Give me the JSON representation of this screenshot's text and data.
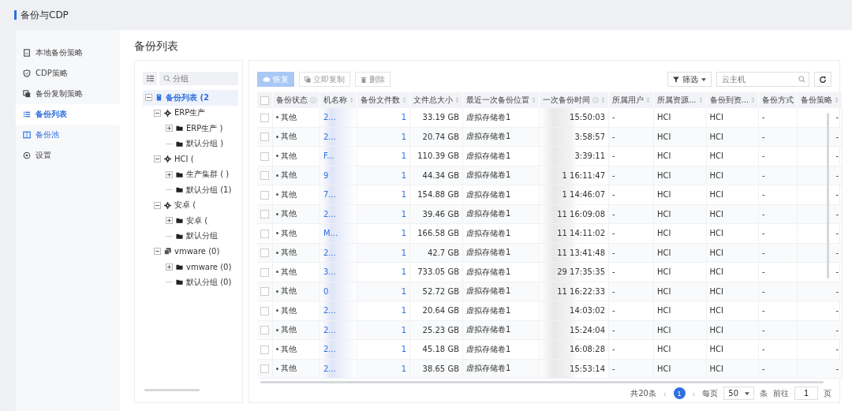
{
  "app_title": "备份与CDP",
  "sidebar": {
    "items": [
      {
        "label": "本地备份策略",
        "selected": false,
        "highlighted": false
      },
      {
        "label": "CDP策略",
        "selected": false,
        "highlighted": false
      },
      {
        "label": "备份复制策略",
        "selected": false,
        "highlighted": false
      },
      {
        "label": "备份列表",
        "selected": true,
        "highlighted": true
      },
      {
        "label": "备份池",
        "selected": false,
        "highlighted": true
      },
      {
        "label": "设置",
        "selected": false,
        "highlighted": false
      }
    ]
  },
  "page_title": "备份列表",
  "tree": {
    "search_placeholder": "分组",
    "nodes": [
      {
        "label": "备份列表 (2",
        "kind": "list",
        "expanded": true,
        "selected": true,
        "children": [
          {
            "label": "ERP生产",
            "kind": "cluster",
            "expanded": true,
            "selected": false,
            "children": [
              {
                "label": "ERP生产 )",
                "kind": "folder",
                "expanded": false,
                "selected": false
              },
              {
                "label": "默认分组 )",
                "kind": "folder",
                "selected": false
              }
            ]
          },
          {
            "label": "HCI (",
            "kind": "cluster",
            "expanded": true,
            "selected": false,
            "children": [
              {
                "label": "生产集群 (  )",
                "kind": "folder",
                "expanded": false,
                "selected": false
              },
              {
                "label": "默认分组 (1)",
                "kind": "folder",
                "selected": false
              }
            ]
          },
          {
            "label": "安卓 (",
            "kind": "cluster",
            "expanded": true,
            "selected": false,
            "children": [
              {
                "label": "安卓 (",
                "kind": "folder",
                "expanded": false,
                "selected": false
              },
              {
                "label": "默认分组",
                "kind": "folder",
                "selected": false
              }
            ]
          },
          {
            "label": "vmware (0)",
            "kind": "vmware",
            "expanded": true,
            "selected": false,
            "children": [
              {
                "label": "vmware (0)",
                "kind": "folder",
                "expanded": false,
                "selected": false
              },
              {
                "label": "默认分组 (0)",
                "kind": "folder",
                "selected": false
              }
            ]
          }
        ]
      }
    ]
  },
  "toolbar": {
    "buttons": [
      {
        "label": "恢复",
        "kind": "primary",
        "disabled": true
      },
      {
        "label": "立即复制",
        "kind": "copy",
        "disabled": true
      },
      {
        "label": "删除",
        "kind": "delete",
        "disabled": true
      }
    ],
    "filter": "筛选",
    "search_placeholder": "云主机"
  },
  "table": {
    "all_checked": false,
    "columns": [
      {
        "label": "备份状态",
        "info": true,
        "sortable": false
      },
      {
        "label": "机名称",
        "info": false,
        "sortable": true
      },
      {
        "label": "备份文件数",
        "info": false,
        "sortable": true
      },
      {
        "label": "文件总大小",
        "info": false,
        "sortable": true
      },
      {
        "label": "最近一次备份位置",
        "info": false,
        "sortable": true
      },
      {
        "label": "一次备份时间",
        "info": true,
        "sortable": true
      },
      {
        "label": "所属用户",
        "info": false,
        "sortable": true
      },
      {
        "label": "所属资源...",
        "info": false,
        "sortable": true
      },
      {
        "label": "备份到资...",
        "info": false,
        "sortable": true
      },
      {
        "label": "备份方式",
        "info": false,
        "sortable": false
      },
      {
        "label": "备份策略",
        "info": false,
        "sortable": true
      }
    ],
    "rows": [
      {
        "checked": false,
        "cells": [
          "其他",
          "2...",
          "1",
          "33.19 GB",
          "虚拟存储卷1",
          "15:50:03",
          "-",
          "HCI",
          "HCI",
          "-",
          "-"
        ]
      },
      {
        "checked": false,
        "cells": [
          "其他",
          "2...",
          "1",
          "20.74 GB",
          "虚拟存储卷1",
          "3:58:57",
          "-",
          "HCI",
          "HCI",
          "-",
          "-"
        ]
      },
      {
        "checked": false,
        "cells": [
          "其他",
          "F...",
          "1",
          "110.39 GB",
          "虚拟存储卷1",
          "3:39:11",
          "-",
          "HCI",
          "HCI",
          "-",
          "-"
        ]
      },
      {
        "checked": false,
        "cells": [
          "其他",
          "9",
          "1",
          "44.34 GB",
          "虚拟存储卷1",
          "1 16:11:47",
          "-",
          "HCI",
          "HCI",
          "-",
          "-"
        ]
      },
      {
        "checked": false,
        "cells": [
          "其他",
          "7...",
          "1",
          "154.88 GB",
          "虚拟存储卷1",
          "1 14:46:07",
          "-",
          "HCI",
          "HCI",
          "-",
          "-"
        ]
      },
      {
        "checked": false,
        "cells": [
          "其他",
          "2...",
          "1",
          "39.46 GB",
          "虚拟存储卷1",
          "11 16:09:08",
          "-",
          "HCI",
          "HCI",
          "-",
          "-"
        ]
      },
      {
        "checked": false,
        "cells": [
          "其他",
          "M...",
          "1",
          "166.58 GB",
          "虚拟存储卷1",
          "11 14:11:02",
          "-",
          "HCI",
          "HCI",
          "-",
          "-"
        ]
      },
      {
        "checked": false,
        "cells": [
          "其他",
          "2...",
          "1",
          "42.7 GB",
          "虚拟存储卷1",
          "11 13:41:48",
          "-",
          "HCI",
          "HCI",
          "-",
          "-"
        ]
      },
      {
        "checked": false,
        "cells": [
          "其他",
          "3...",
          "1",
          "733.05 GB",
          "虚拟存储卷1",
          "29 17:35:35",
          "-",
          "HCI",
          "HCI",
          "-",
          "-"
        ]
      },
      {
        "checked": false,
        "cells": [
          "其他",
          "0",
          "1",
          "52.72 GB",
          "虚拟存储卷1",
          "11 16:22:33",
          "-",
          "HCI",
          "HCI",
          "-",
          "-"
        ]
      },
      {
        "checked": false,
        "cells": [
          "其他",
          "2...",
          "1",
          "20.64 GB",
          "虚拟存储卷1",
          "14:03:02",
          "-",
          "HCI",
          "HCI",
          "-",
          "-"
        ]
      },
      {
        "checked": false,
        "cells": [
          "其他",
          "2...",
          "1",
          "25.23 GB",
          "虚拟存储卷1",
          "15:24:04",
          "-",
          "HCI",
          "HCI",
          "-",
          "-"
        ]
      },
      {
        "checked": false,
        "cells": [
          "其他",
          "2...",
          "1",
          "45.18 GB",
          "虚拟存储卷1",
          "16:08:28",
          "-",
          "HCI",
          "HCI",
          "-",
          "-"
        ]
      },
      {
        "checked": false,
        "cells": [
          "其他",
          "2...",
          "1",
          "38.65 GB",
          "虚拟存储卷1",
          "15:53:14",
          "-",
          "HCI",
          "HCI",
          "-",
          "-"
        ]
      }
    ]
  },
  "pagination": {
    "total": "共20条",
    "prev": "‹",
    "pages": [
      {
        "label": "1",
        "selected": true
      }
    ],
    "next": "›",
    "per_page_label": "每页",
    "per_page": "50",
    "per_page_unit": "条",
    "goto_label": "前往",
    "goto_value": "1",
    "goto_unit": "页"
  }
}
